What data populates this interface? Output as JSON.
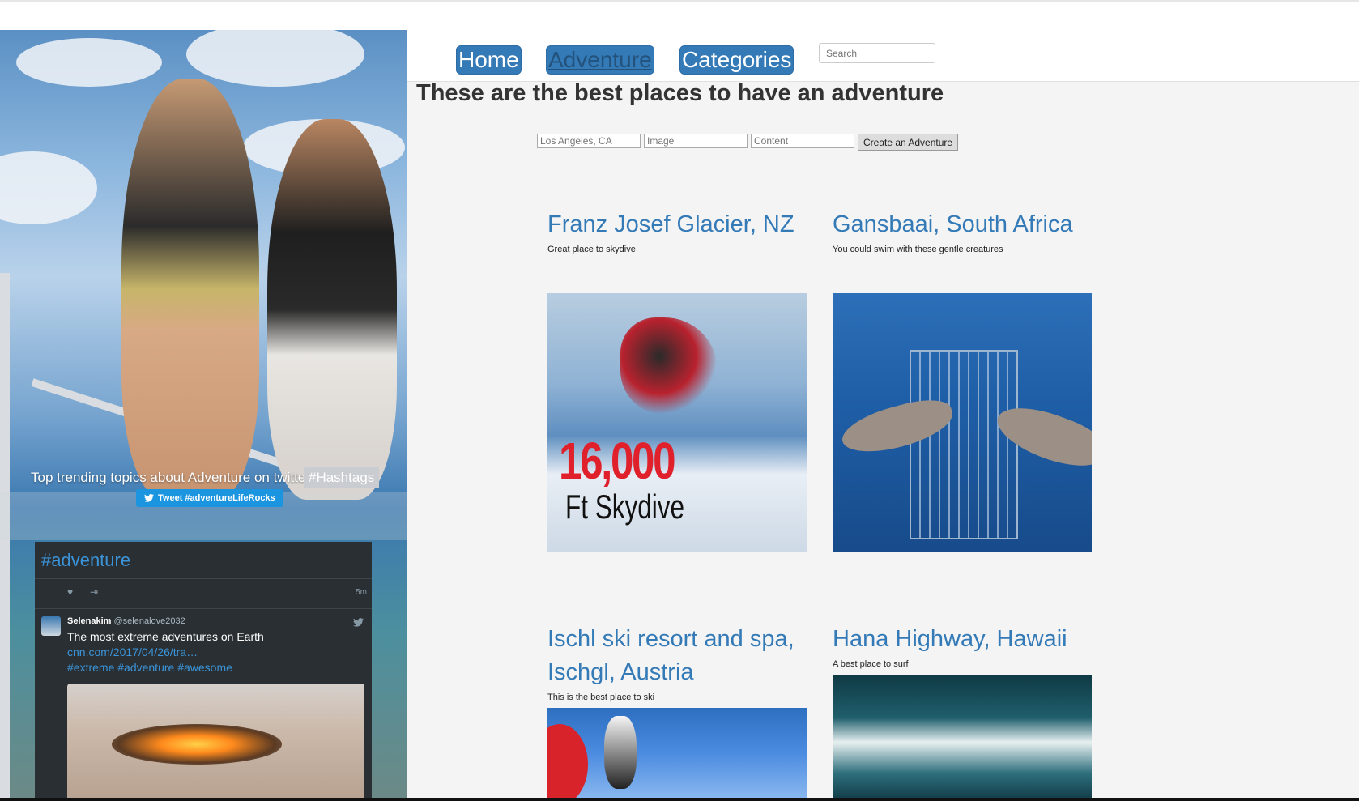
{
  "nav": {
    "home": "Home",
    "adventure": "Adventure",
    "categories": "Categories",
    "search_placeholder": "Search"
  },
  "page": {
    "title": "These are the best places to have an adventure"
  },
  "form": {
    "location_placeholder": "Los Angeles, CA",
    "image_placeholder": "Image",
    "content_placeholder": "Content",
    "submit_label": "Create an Adventure"
  },
  "adventures": [
    {
      "title": "Franz Josef Glacier, NZ",
      "description": "Great place to skydive",
      "image_text_1": "16,000",
      "image_text_2": "Ft Skydive"
    },
    {
      "title": "Gansbaai, South Africa",
      "description": "You could swim with these gentle creatures"
    },
    {
      "title": "Ischl ski resort and spa, Ischgl, Austria",
      "description": "This is the best place to ski"
    },
    {
      "title": "Hana Highway, Hawaii",
      "description": "A best place to surf"
    }
  ],
  "sidebar": {
    "trending_text": "Top trending topics about Adventure on twitter",
    "hashtags_label": "#Hashtags",
    "tweet_button": "Tweet #adventureLifeRocks",
    "widget": {
      "title": "#adventure",
      "time": "5m",
      "tweet": {
        "name": "Selenakim",
        "handle": "@selenalove2032",
        "text": "The most extreme adventures on Earth",
        "link": "cnn.com/2017/04/26/tra…",
        "tags": "#extreme #adventure #awesome"
      }
    }
  },
  "colors": {
    "link_blue": "#337ab7",
    "twitter_blue": "#1b95e0",
    "widget_bg": "#292f33"
  }
}
